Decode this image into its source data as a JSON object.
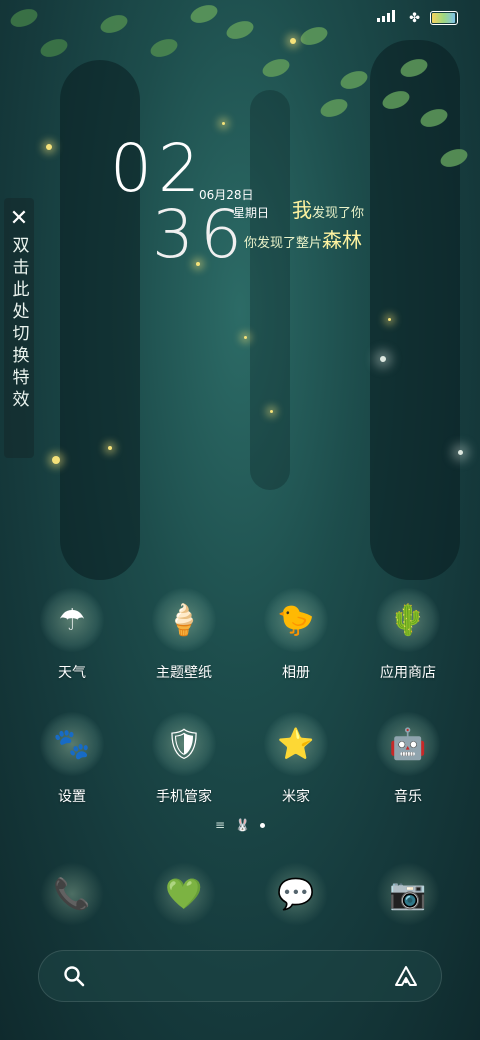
{
  "status_bar": {
    "signal_icon": "signal-bars-icon",
    "wifi_icon": "clover-icon",
    "battery_level": 0.9
  },
  "clock": {
    "hour": "02",
    "minute": "36",
    "date": "06月28日",
    "weekday": "星期日"
  },
  "slogan": {
    "line1_big": "我",
    "line1_rest": "发现了你",
    "line2_rest": "你发现了整片",
    "line2_big": "森林"
  },
  "effect_panel": {
    "close_glyph": "✕",
    "text": "双击此处切换特效"
  },
  "apps": [
    {
      "label": "天气",
      "icon": "umbrella-icon",
      "glyph": "☂"
    },
    {
      "label": "主题壁纸",
      "icon": "ice-cream-icon",
      "glyph": "🍦"
    },
    {
      "label": "相册",
      "icon": "duck-icon",
      "glyph": "🐤"
    },
    {
      "label": "应用商店",
      "icon": "cactus-icon",
      "glyph": "🌵"
    },
    {
      "label": "设置",
      "icon": "cat-paw-icon",
      "glyph": "🐾"
    },
    {
      "label": "手机管家",
      "icon": "shield-icon",
      "glyph": "🛡"
    },
    {
      "label": "米家",
      "icon": "star-wand-icon",
      "glyph": "⭐"
    },
    {
      "label": "音乐",
      "icon": "yellow-robot-icon",
      "glyph": "🤖"
    }
  ],
  "pager": {
    "menu_glyph": "≡",
    "bunny_glyph": "🐰"
  },
  "dock": [
    {
      "icon": "phone-bag-icon",
      "glyph": "📞"
    },
    {
      "icon": "browser-heart-icon",
      "glyph": "💚"
    },
    {
      "icon": "message-bunny-icon",
      "glyph": "💬"
    },
    {
      "icon": "camera-icon",
      "glyph": "📷"
    }
  ],
  "colors": {
    "accent": "#fff3a0",
    "background": "#1d4d4c"
  }
}
